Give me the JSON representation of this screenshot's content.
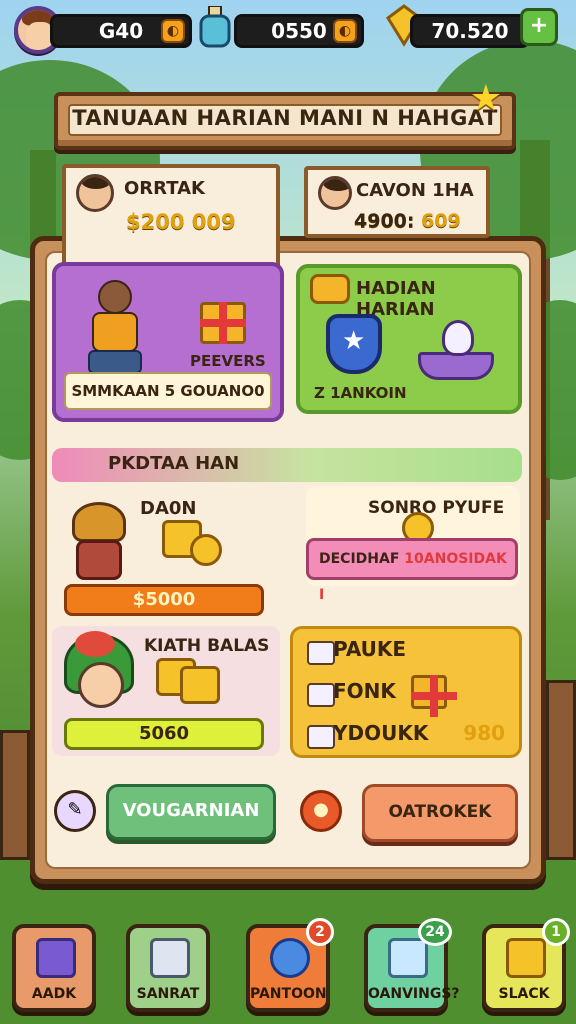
{
  "resources": {
    "gold": "G40",
    "potion": "0550",
    "gems": "70.520",
    "add_label": "+"
  },
  "title": "TANUAAN HARIAN MANI N HAHGAT",
  "players": [
    {
      "name": "ORRTAK",
      "score": "$200 009"
    },
    {
      "name": "CAVON 1HA",
      "score": "4900:",
      "score_bonus": "609"
    }
  ],
  "panels": {
    "daily_chest": {
      "reward_label": "PEEVERS",
      "bar_text": "SMMKAAN 5 GOUANO0"
    },
    "daily_reward": {
      "title": "HADIAN HARIAN",
      "footer": "Z 1ANKOIN"
    }
  },
  "progress_strip": {
    "label": "PKDTAA HAN"
  },
  "rewards": {
    "left1": {
      "title": "DA0N",
      "value": "$5000"
    },
    "right1": {
      "title": "SONRO PYUFE",
      "bar_prefix": "DECIDHAF",
      "bar_value": "10ANOSIDAK I"
    },
    "left2": {
      "title": "KIATH BALAS",
      "value": "5060"
    },
    "right2": {
      "rows": [
        {
          "label": "PAUKE"
        },
        {
          "label": "FONK"
        },
        {
          "label": "YDOUKK",
          "value": "980"
        }
      ]
    }
  },
  "actions": {
    "primary": "VOUGARNIAN",
    "secondary": "OATROKEK"
  },
  "nav": [
    {
      "label": "AADK",
      "color": "#e99a6a",
      "icon": "whistle-icon"
    },
    {
      "label": "SANRAT",
      "color": "#9ed08a",
      "icon": "scroll-icon"
    },
    {
      "label": "PANTOON",
      "color": "#f07c3a",
      "icon": "star-icon",
      "badge": "2",
      "badge_color": "#e04a2a"
    },
    {
      "label": "OANVINGS?",
      "color": "#6fd0a0",
      "icon": "cloth-icon",
      "badge": "24",
      "badge_color": "#3aa04a"
    },
    {
      "label": "SLACK",
      "color": "#e6e65a",
      "icon": "ticket-icon",
      "badge": "1",
      "badge_color": "#6ab02a"
    }
  ]
}
